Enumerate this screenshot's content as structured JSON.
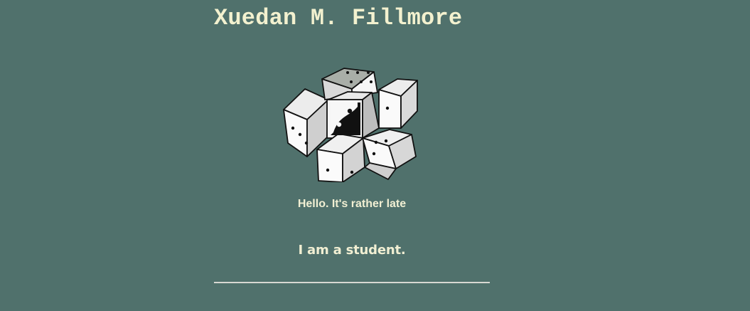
{
  "page": {
    "title": "Xuedan M. Fillmore",
    "greeting": "Hello. It's rather late",
    "tagline": "I am a student.",
    "logo_icon": "dice-cluster-icon"
  },
  "colors": {
    "background": "#50716c",
    "text": "#f3f1cf",
    "rule": "#d8d8d2"
  }
}
